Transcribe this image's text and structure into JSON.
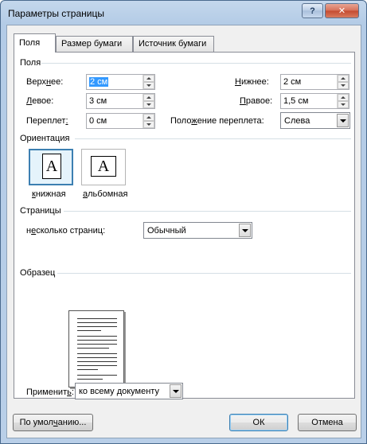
{
  "window": {
    "title": "Параметры страницы",
    "help_label": "?",
    "close_label": "✕"
  },
  "tabs": [
    {
      "label": "Поля",
      "active": true
    },
    {
      "label": "Размер бумаги",
      "active": false
    },
    {
      "label": "Источник бумаги",
      "active": false
    }
  ],
  "margins": {
    "group_label": "Поля",
    "top": {
      "label_pre": "Верх",
      "label_u": "н",
      "label_post": "ее:",
      "value": "2 см"
    },
    "left": {
      "label_pre": "",
      "label_u": "Л",
      "label_post": "евое:",
      "value": "3 см"
    },
    "gutter": {
      "label_pre": "Переплет",
      "label_u": ":",
      "label_post": "",
      "value": "0 см"
    },
    "bottom": {
      "label_pre": "",
      "label_u": "Н",
      "label_post": "ижнее:",
      "value": "2 см"
    },
    "right": {
      "label_pre": "",
      "label_u": "П",
      "label_post": "равое:",
      "value": "1,5 см"
    },
    "gutter_pos": {
      "label_pre": "Поло",
      "label_u": "ж",
      "label_post": "ение переплета:",
      "value": "Слева"
    }
  },
  "orientation": {
    "group_label": "Ориентация",
    "portrait": {
      "label_pre": "",
      "label_u": "к",
      "label_post": "нижная",
      "glyph": "A"
    },
    "landscape": {
      "label_pre": "",
      "label_u": "а",
      "label_post": "льбомная",
      "glyph": "A"
    }
  },
  "pages": {
    "group_label": "Страницы",
    "multiple_label_pre": "н",
    "multiple_label_u": "е",
    "multiple_label_post": "сколько страниц:",
    "multiple_value": "Обычный"
  },
  "preview": {
    "group_label": "Образец"
  },
  "apply": {
    "label_pre": "Применит",
    "label_u": "ь",
    "label_post": ":",
    "value": "ко всему документу"
  },
  "buttons": {
    "default_label_pre": "По умол",
    "default_label_u": "ч",
    "default_label_post": "анию...",
    "ok_label": "ОК",
    "cancel_label": "Отмена"
  }
}
